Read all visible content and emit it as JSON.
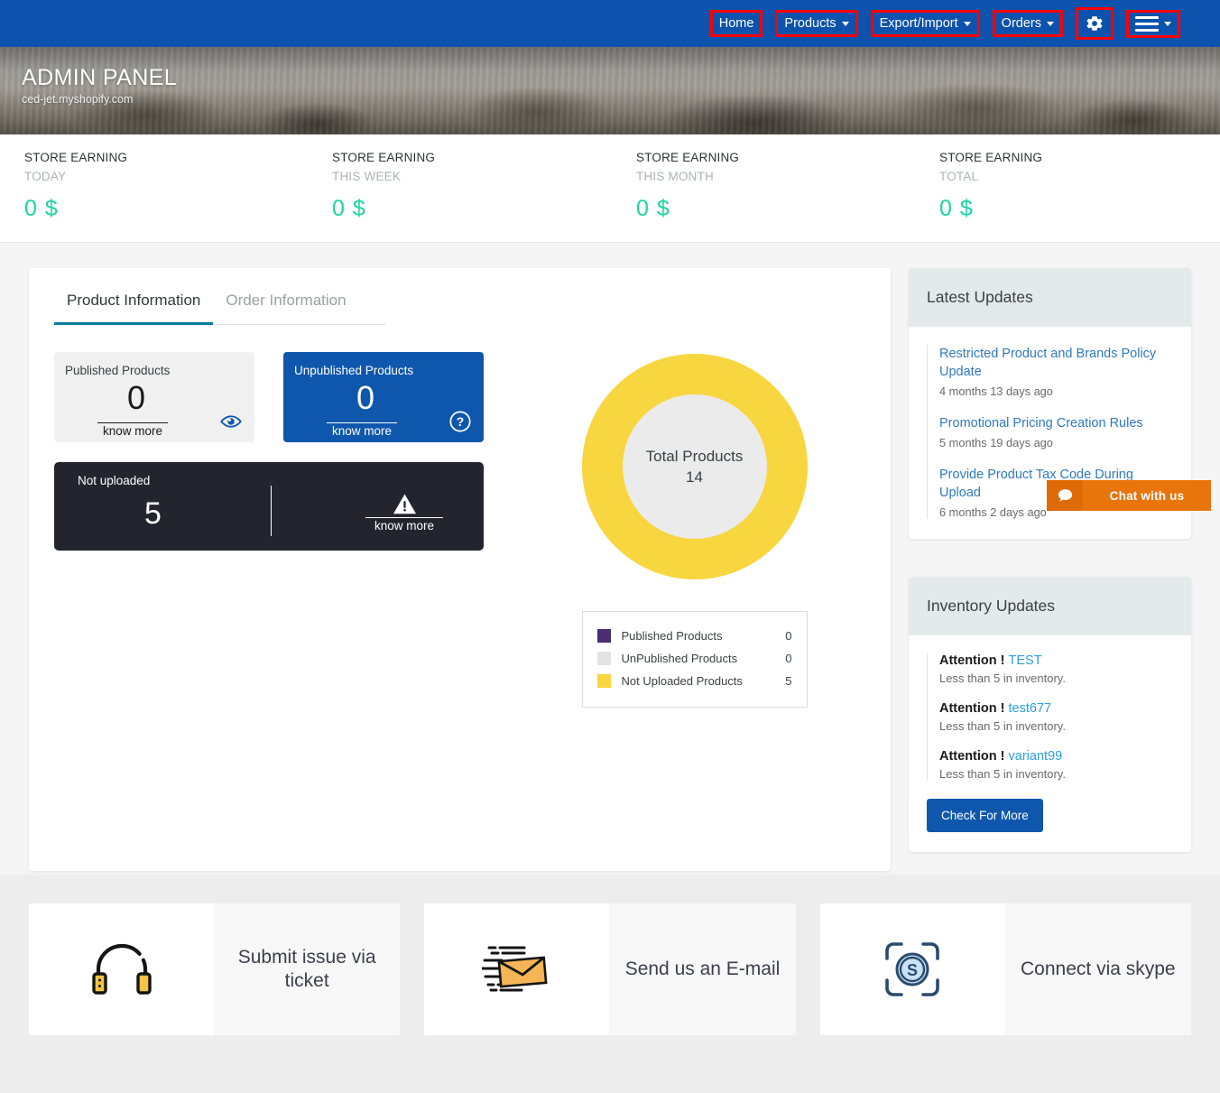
{
  "navbar": {
    "items": [
      {
        "label": "Home",
        "icon": "",
        "has_caret": false,
        "boxed": true
      },
      {
        "label": "Products",
        "icon": "",
        "has_caret": true,
        "boxed": true
      },
      {
        "label": "Export/Import",
        "icon": "",
        "has_caret": true,
        "boxed": true
      },
      {
        "label": "Orders",
        "icon": "",
        "has_caret": true,
        "boxed": true
      }
    ],
    "settings_icon": "gear-icon",
    "menu_icon": "hamburger-icon",
    "highlight_color": "#fe0000",
    "background_color": "#0d52ac"
  },
  "hero": {
    "title": "ADMIN PANEL",
    "subtitle": "ced-jet.myshopify.com"
  },
  "earnings": {
    "cards": [
      {
        "title": "STORE EARNING",
        "period": "TODAY",
        "value": "0 $"
      },
      {
        "title": "STORE EARNING",
        "period": "THIS WEEK",
        "value": "0 $"
      },
      {
        "title": "STORE EARNING",
        "period": "THIS MONTH",
        "value": "0 $"
      },
      {
        "title": "STORE EARNING",
        "period": "TOTAL",
        "value": "0 $"
      }
    ],
    "value_color": "#1ad5a3"
  },
  "main": {
    "tabs": [
      {
        "label": "Product Information",
        "active": true
      },
      {
        "label": "Order Information",
        "active": false
      }
    ],
    "published_card": {
      "label": "Published Products",
      "value": "0",
      "know_more": "know more",
      "icon": "eye-icon"
    },
    "unpublished_card": {
      "label": "Unpublished Products",
      "value": "0",
      "know_more": "know more",
      "icon": "question-circle-icon"
    },
    "not_uploaded_card": {
      "label": "Not uploaded",
      "value": "5",
      "know_more": "know more",
      "icon": "warning-triangle-icon"
    }
  },
  "chart_data": {
    "type": "pie",
    "title": "Total Products",
    "center_label": "Total Products",
    "center_value": "14",
    "categories": [
      "Published Products",
      "UnPublished Products",
      "Not Uploaded Products"
    ],
    "values": [
      0,
      0,
      5
    ],
    "colors": [
      "#4b2e6f",
      "#e3e3e3",
      "#f8d63f"
    ],
    "legend_position": "bottom",
    "donut": true
  },
  "latest_updates": {
    "heading": "Latest Updates",
    "items": [
      {
        "title": "Restricted Product and Brands Policy Update",
        "date": "4 months 13 days ago"
      },
      {
        "title": "Promotional Pricing Creation Rules",
        "date": "5 months 19 days ago"
      },
      {
        "title": "Provide Product Tax Code During Upload",
        "date": "6 months 2 days ago"
      }
    ]
  },
  "inventory_updates": {
    "heading": "Inventory Updates",
    "attention_prefix": "Attention !",
    "items": [
      {
        "name": "TEST",
        "message": "Less than 5 in inventory."
      },
      {
        "name": "test677",
        "message": "Less than 5 in inventory."
      },
      {
        "name": "variant99",
        "message": "Less than 5 in inventory."
      }
    ],
    "button_label": "Check For More"
  },
  "chat_widget": {
    "label": "Chat with us",
    "icon": "chat-bubble-icon",
    "color": "#e8740c"
  },
  "support": {
    "cards": [
      {
        "label": "Submit issue via ticket",
        "icon": "headphones-icon"
      },
      {
        "label": "Send us an E-mail",
        "icon": "envelope-icon"
      },
      {
        "label": "Connect via skype",
        "icon": "skype-icon"
      }
    ]
  }
}
